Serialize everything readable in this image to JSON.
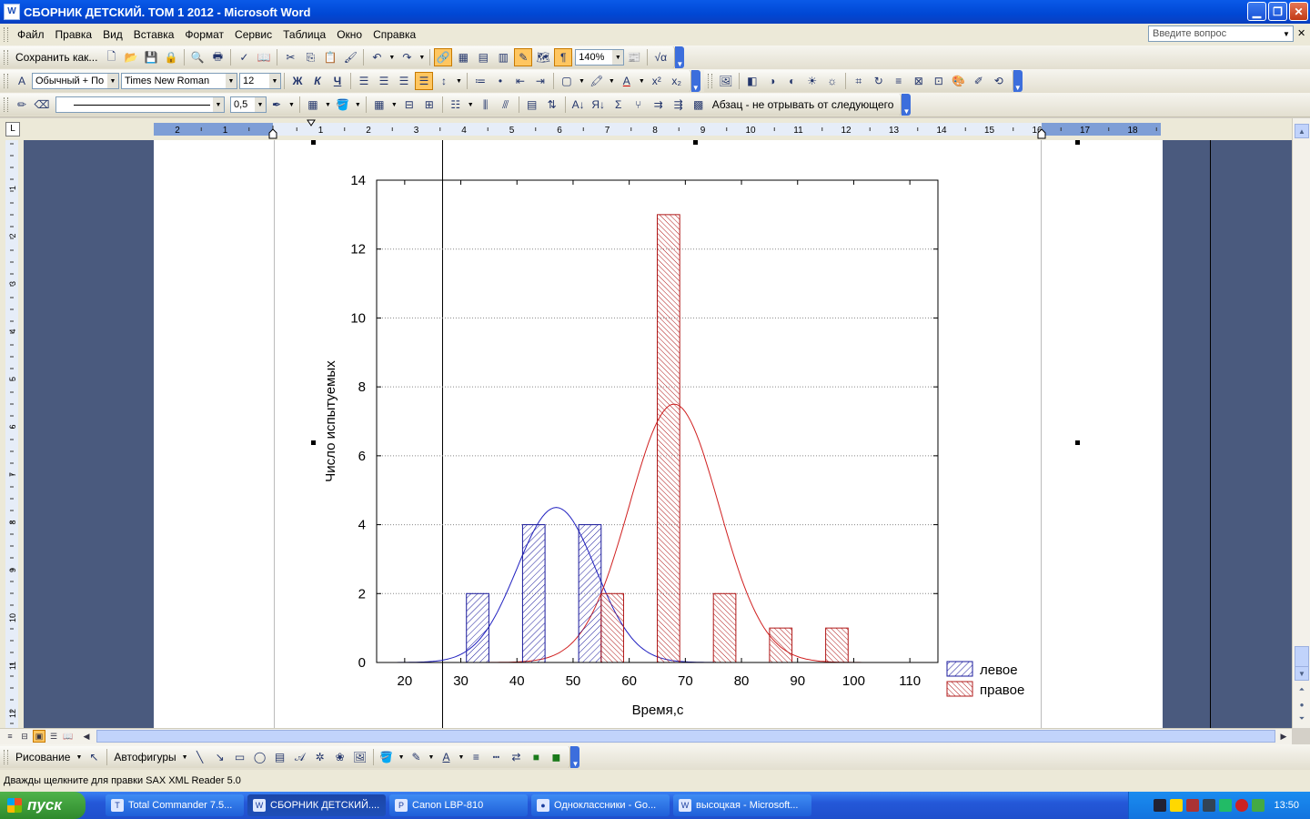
{
  "window": {
    "title": "СБОРНИК ДЕТСКИЙ. ТОМ 1 2012 - Microsoft Word",
    "app_icon_glyph": "W"
  },
  "menu": {
    "items": [
      "Файл",
      "Правка",
      "Вид",
      "Вставка",
      "Формат",
      "Сервис",
      "Таблица",
      "Окно",
      "Справка"
    ],
    "help_placeholder": "Введите вопрос"
  },
  "toolbar1": {
    "save_as_label": "Сохранить как...",
    "zoom": "140%"
  },
  "toolbar2": {
    "style": "Обычный + По ц",
    "font": "Times New Roman",
    "size": "12"
  },
  "toolbar3": {
    "line_width": "0,5",
    "keep_with_next": "Абзац - не отрывать от следующего"
  },
  "ruler": {
    "labels": [
      "2",
      "1",
      "1",
      "2",
      "3",
      "4",
      "5",
      "6",
      "7",
      "8",
      "9",
      "10",
      "11",
      "12",
      "13",
      "14",
      "15",
      "16",
      "17",
      "18"
    ]
  },
  "chart_data": {
    "type": "bar",
    "title": "",
    "xlabel": "Время,с",
    "ylabel": "Число испытуемых",
    "xlim": [
      15,
      115
    ],
    "ylim": [
      0,
      14
    ],
    "xticks": [
      20,
      30,
      40,
      50,
      60,
      70,
      80,
      90,
      100,
      110
    ],
    "yticks": [
      0,
      2,
      4,
      6,
      8,
      10,
      12,
      14
    ],
    "grid": "horizontal dotted",
    "legend_position": "bottom-right outside",
    "series": [
      {
        "name": "левое",
        "color": "#1a1a9c",
        "x": [
          33,
          43,
          53
        ],
        "values": [
          2,
          4,
          4
        ]
      },
      {
        "name": "правое",
        "color": "#b01818",
        "x": [
          57,
          67,
          77,
          87,
          97
        ],
        "values": [
          2,
          13,
          2,
          1,
          1
        ]
      }
    ],
    "curves": [
      {
        "series": "левое",
        "color": "#2020c0",
        "mean": 47,
        "sd": 7,
        "peak": 4.5
      },
      {
        "series": "правое",
        "color": "#d02020",
        "mean": 68,
        "sd": 8,
        "peak": 7.5
      }
    ]
  },
  "drawing_toolbar": {
    "draw_label": "Рисование",
    "autoshapes_label": "Автофигуры"
  },
  "status": {
    "text": "Дважды щелкните для правки SAX XML Reader 5.0"
  },
  "taskbar": {
    "start_label": "пуск",
    "tasks": [
      "Total Commander 7.5...",
      "СБОРНИК ДЕТСКИЙ....",
      "Canon LBP-810",
      "Одноклассники - Go...",
      "высоцкая - Microsoft..."
    ],
    "clock": "13:50"
  }
}
